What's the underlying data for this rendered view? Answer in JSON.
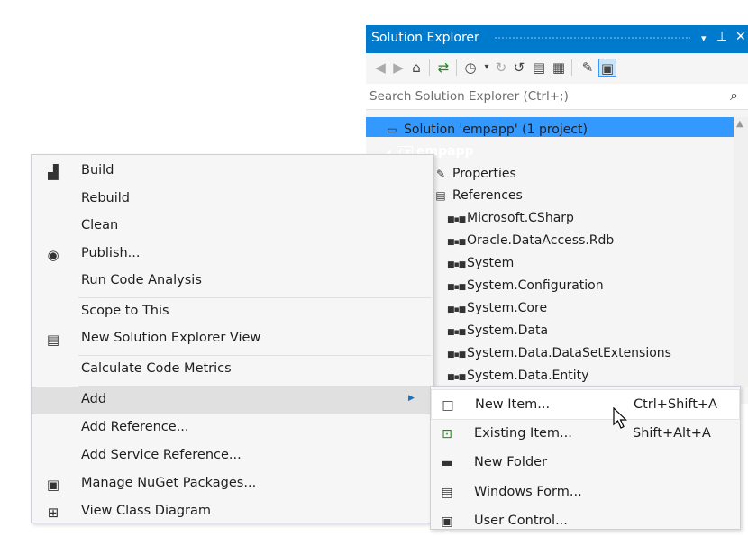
{
  "solution_explorer": {
    "title": "Solution Explorer",
    "title_buttons": [
      "▾",
      "⊥",
      "✕"
    ],
    "search_placeholder": "Search Solution Explorer (Ctrl+;)",
    "tree": {
      "solution": "Solution 'empapp' (1 project)",
      "project": "empapp",
      "properties": "Properties",
      "references": "References",
      "refs": [
        "Microsoft.CSharp",
        "Oracle.DataAccess.Rdb",
        "System",
        "System.Configuration",
        "System.Core",
        "System.Data",
        "System.Data.DataSetExtensions",
        "System.Data.Entity"
      ]
    }
  },
  "context_menu": {
    "items": [
      {
        "label": "Build",
        "icon": "build-icon"
      },
      {
        "label": "Rebuild"
      },
      {
        "label": "Clean"
      },
      {
        "label": "Publish...",
        "icon": "publish-icon"
      },
      {
        "label": "Run Code Analysis"
      },
      {
        "label": "Scope to This"
      },
      {
        "label": "New Solution Explorer View",
        "icon": "new-view-icon"
      },
      {
        "label": "Calculate Code Metrics"
      },
      {
        "label": "Add",
        "submenu": true
      },
      {
        "label": "Add Reference..."
      },
      {
        "label": "Add Service Reference..."
      },
      {
        "label": "Manage NuGet Packages...",
        "icon": "nuget-icon"
      },
      {
        "label": "View Class Diagram",
        "icon": "class-diagram-icon"
      }
    ]
  },
  "add_submenu": {
    "items": [
      {
        "label": "New Item...",
        "shortcut": "Ctrl+Shift+A",
        "icon": "new-item-icon"
      },
      {
        "label": "Existing Item...",
        "shortcut": "Shift+Alt+A",
        "icon": "existing-item-icon"
      },
      {
        "label": "New Folder",
        "icon": "new-folder-icon"
      },
      {
        "label": "Windows Form...",
        "icon": "windows-form-icon"
      },
      {
        "label": "User Control...",
        "icon": "user-control-icon"
      }
    ]
  },
  "colors": {
    "title_bar": "#007acc",
    "selection": "#3399ff",
    "menu_bg": "#f6f6f6",
    "menu_highlight": "#e0e0e0",
    "submenu_arrow": "#1e70c0"
  }
}
